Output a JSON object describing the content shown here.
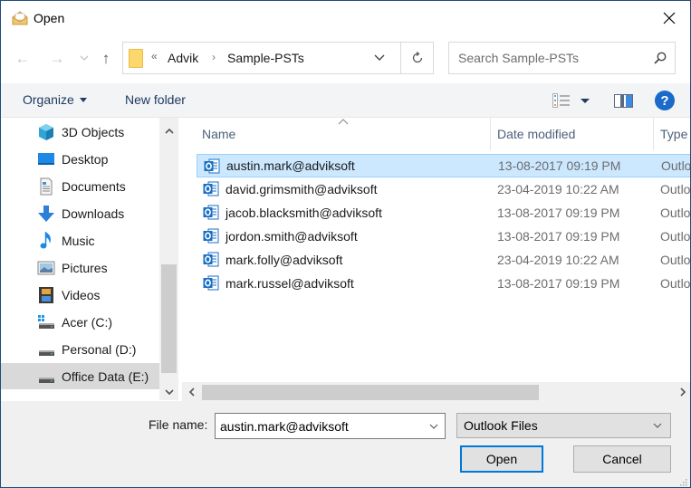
{
  "window": {
    "title": "Open",
    "title_icon": "open-envelope-icon",
    "close_icon": "close-icon"
  },
  "nav": {
    "back_icon": "arrow-left-icon",
    "forward_icon": "arrow-right-icon",
    "recent_icon": "chevron-down-icon",
    "up_icon": "arrow-up-icon",
    "back_glyph": "←",
    "forward_glyph": "→",
    "recent_glyph": "⌄",
    "up_glyph": "↑"
  },
  "address": {
    "overflow_glyph": "«",
    "breadcrumbs": [
      {
        "label": "Advik"
      },
      {
        "label": "Sample-PSTs"
      }
    ],
    "separator_glyph": "›",
    "refresh_icon": "refresh-icon"
  },
  "search": {
    "placeholder": "Search Sample-PSTs",
    "icon": "search-icon"
  },
  "toolbar": {
    "organize_label": "Organize",
    "new_folder_label": "New folder",
    "views_icon": "details-view-icon",
    "preview_icon": "preview-pane-icon",
    "help_glyph": "?"
  },
  "sidebar": {
    "items": [
      {
        "label": "3D Objects",
        "icon": "3d-objects-icon"
      },
      {
        "label": "Desktop",
        "icon": "desktop-icon"
      },
      {
        "label": "Documents",
        "icon": "documents-icon"
      },
      {
        "label": "Downloads",
        "icon": "downloads-icon"
      },
      {
        "label": "Music",
        "icon": "music-icon"
      },
      {
        "label": "Pictures",
        "icon": "pictures-icon"
      },
      {
        "label": "Videos",
        "icon": "videos-icon"
      },
      {
        "label": "Acer (C:)",
        "icon": "system-drive-icon"
      },
      {
        "label": "Personal (D:)",
        "icon": "drive-icon"
      },
      {
        "label": "Office Data (E:)",
        "icon": "drive-icon",
        "selected": true
      }
    ]
  },
  "filelist": {
    "columns": [
      {
        "label": "Name"
      },
      {
        "label": "Date modified"
      },
      {
        "label": "Type"
      }
    ],
    "sort_column": "Name",
    "sort_direction": "ascending",
    "rows": [
      {
        "name": "austin.mark@adviksoft",
        "date": "13-08-2017 09:19 PM",
        "type": "Outlo",
        "selected": true
      },
      {
        "name": "david.grimsmith@adviksoft",
        "date": "23-04-2019 10:22 AM",
        "type": "Outlo"
      },
      {
        "name": "jacob.blacksmith@adviksoft",
        "date": "13-08-2017 09:19 PM",
        "type": "Outlo"
      },
      {
        "name": "jordon.smith@adviksoft",
        "date": "13-08-2017 09:19 PM",
        "type": "Outlo"
      },
      {
        "name": "mark.folly@adviksoft",
        "date": "23-04-2019 10:22 AM",
        "type": "Outlo"
      },
      {
        "name": "mark.russel@adviksoft",
        "date": "13-08-2017 09:19 PM",
        "type": "Outlo"
      }
    ]
  },
  "bottom": {
    "file_name_label": "File name:",
    "file_name_value": "austin.mark@adviksoft",
    "file_type_value": "Outlook Files",
    "open_label": "Open",
    "cancel_label": "Cancel"
  },
  "colors": {
    "accent": "#0078d7",
    "selection_bg": "#cce8ff",
    "selection_border": "#99d1ff",
    "toolbar_text": "#1e3b60",
    "help_blue": "#1b6ac9"
  }
}
